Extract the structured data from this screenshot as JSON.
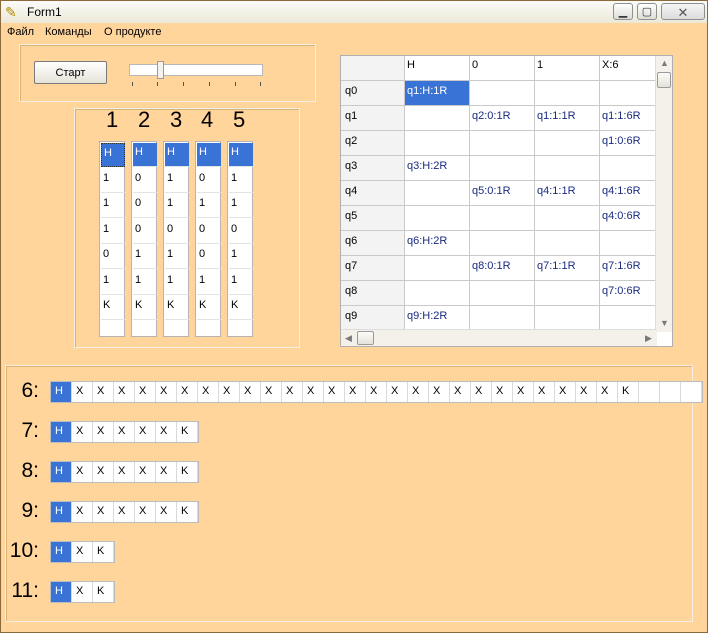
{
  "window": {
    "title": "Form1"
  },
  "menu": [
    "Файл",
    "Команды",
    "О продукте"
  ],
  "start_button": "Старт",
  "columns": {
    "headers": [
      "1",
      "2",
      "3",
      "4",
      "5"
    ],
    "cells": [
      [
        "H",
        "1",
        "1",
        "1",
        "0",
        "1",
        "K"
      ],
      [
        "H",
        "0",
        "0",
        "0",
        "1",
        "1",
        "K"
      ],
      [
        "H",
        "1",
        "1",
        "0",
        "1",
        "1",
        "K"
      ],
      [
        "H",
        "0",
        "1",
        "0",
        "0",
        "1",
        "K"
      ],
      [
        "H",
        "1",
        "1",
        "0",
        "1",
        "1",
        "K"
      ]
    ]
  },
  "table": {
    "headers": [
      "",
      "H",
      "0",
      "1",
      "X:6"
    ],
    "rows": [
      [
        "q0",
        "q1:H:1R",
        "",
        "",
        ""
      ],
      [
        "q1",
        "",
        "q2:0:1R",
        "q1:1:1R",
        "q1:1:6R"
      ],
      [
        "q2",
        "",
        "",
        "",
        "q1:0:6R"
      ],
      [
        "q3",
        "q3:H:2R",
        "",
        "",
        ""
      ],
      [
        "q4",
        "",
        "q5:0:1R",
        "q4:1:1R",
        "q4:1:6R"
      ],
      [
        "q5",
        "",
        "",
        "",
        "q4:0:6R"
      ],
      [
        "q6",
        "q6:H:2R",
        "",
        "",
        ""
      ],
      [
        "q7",
        "",
        "q8:0:1R",
        "q7:1:1R",
        "q7:1:6R"
      ],
      [
        "q8",
        "",
        "",
        "",
        "q7:0:6R"
      ],
      [
        "q9",
        "q9:H:2R",
        "",
        "",
        ""
      ]
    ]
  },
  "tapes": [
    {
      "label": "6:",
      "cells": [
        "H",
        "X",
        "X",
        "X",
        "X",
        "X",
        "X",
        "X",
        "X",
        "X",
        "X",
        "X",
        "X",
        "X",
        "X",
        "X",
        "X",
        "X",
        "X",
        "X",
        "X",
        "X",
        "X",
        "X",
        "X",
        "X",
        "X",
        "K",
        "",
        "",
        ""
      ]
    },
    {
      "label": "7:",
      "cells": [
        "H",
        "X",
        "X",
        "X",
        "X",
        "X",
        "K"
      ]
    },
    {
      "label": "8:",
      "cells": [
        "H",
        "X",
        "X",
        "X",
        "X",
        "X",
        "K"
      ]
    },
    {
      "label": "9:",
      "cells": [
        "H",
        "X",
        "X",
        "X",
        "X",
        "X",
        "K"
      ]
    },
    {
      "label": "10:",
      "cells": [
        "H",
        "X",
        "K"
      ]
    },
    {
      "label": "11:",
      "cells": [
        "H",
        "X",
        "K"
      ]
    }
  ]
}
